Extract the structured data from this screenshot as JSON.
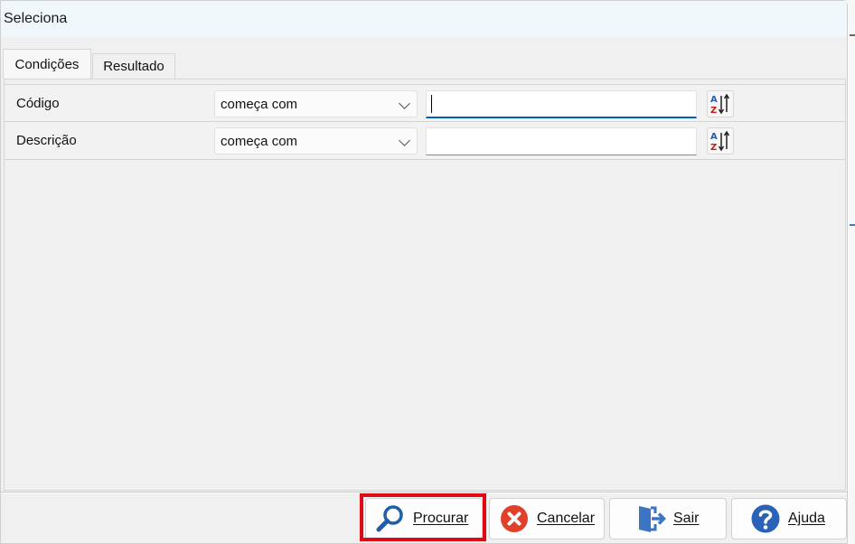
{
  "dialog": {
    "title": "Seleciona"
  },
  "tabs": [
    {
      "label": "Condições",
      "active": true
    },
    {
      "label": "Resultado",
      "active": false
    }
  ],
  "conditions": [
    {
      "field": "Código",
      "operator": "começa com",
      "value": "",
      "focused": true
    },
    {
      "field": "Descrição",
      "operator": "começa com",
      "value": "",
      "focused": false
    }
  ],
  "buttons": {
    "search_label": "Procurar",
    "cancel_label": "Cancelar",
    "exit_label": "Sair",
    "help_label": "Ajuda"
  },
  "icons": {
    "search": "magnifier-icon",
    "cancel": "cancel-circle-icon",
    "exit": "exit-door-icon",
    "help": "help-question-icon",
    "sort": "sort-az-icon"
  },
  "colors": {
    "accent": "#005fb8",
    "highlight": "#e10a14",
    "cancel_red": "#e0402a",
    "help_blue": "#2a62b8"
  }
}
